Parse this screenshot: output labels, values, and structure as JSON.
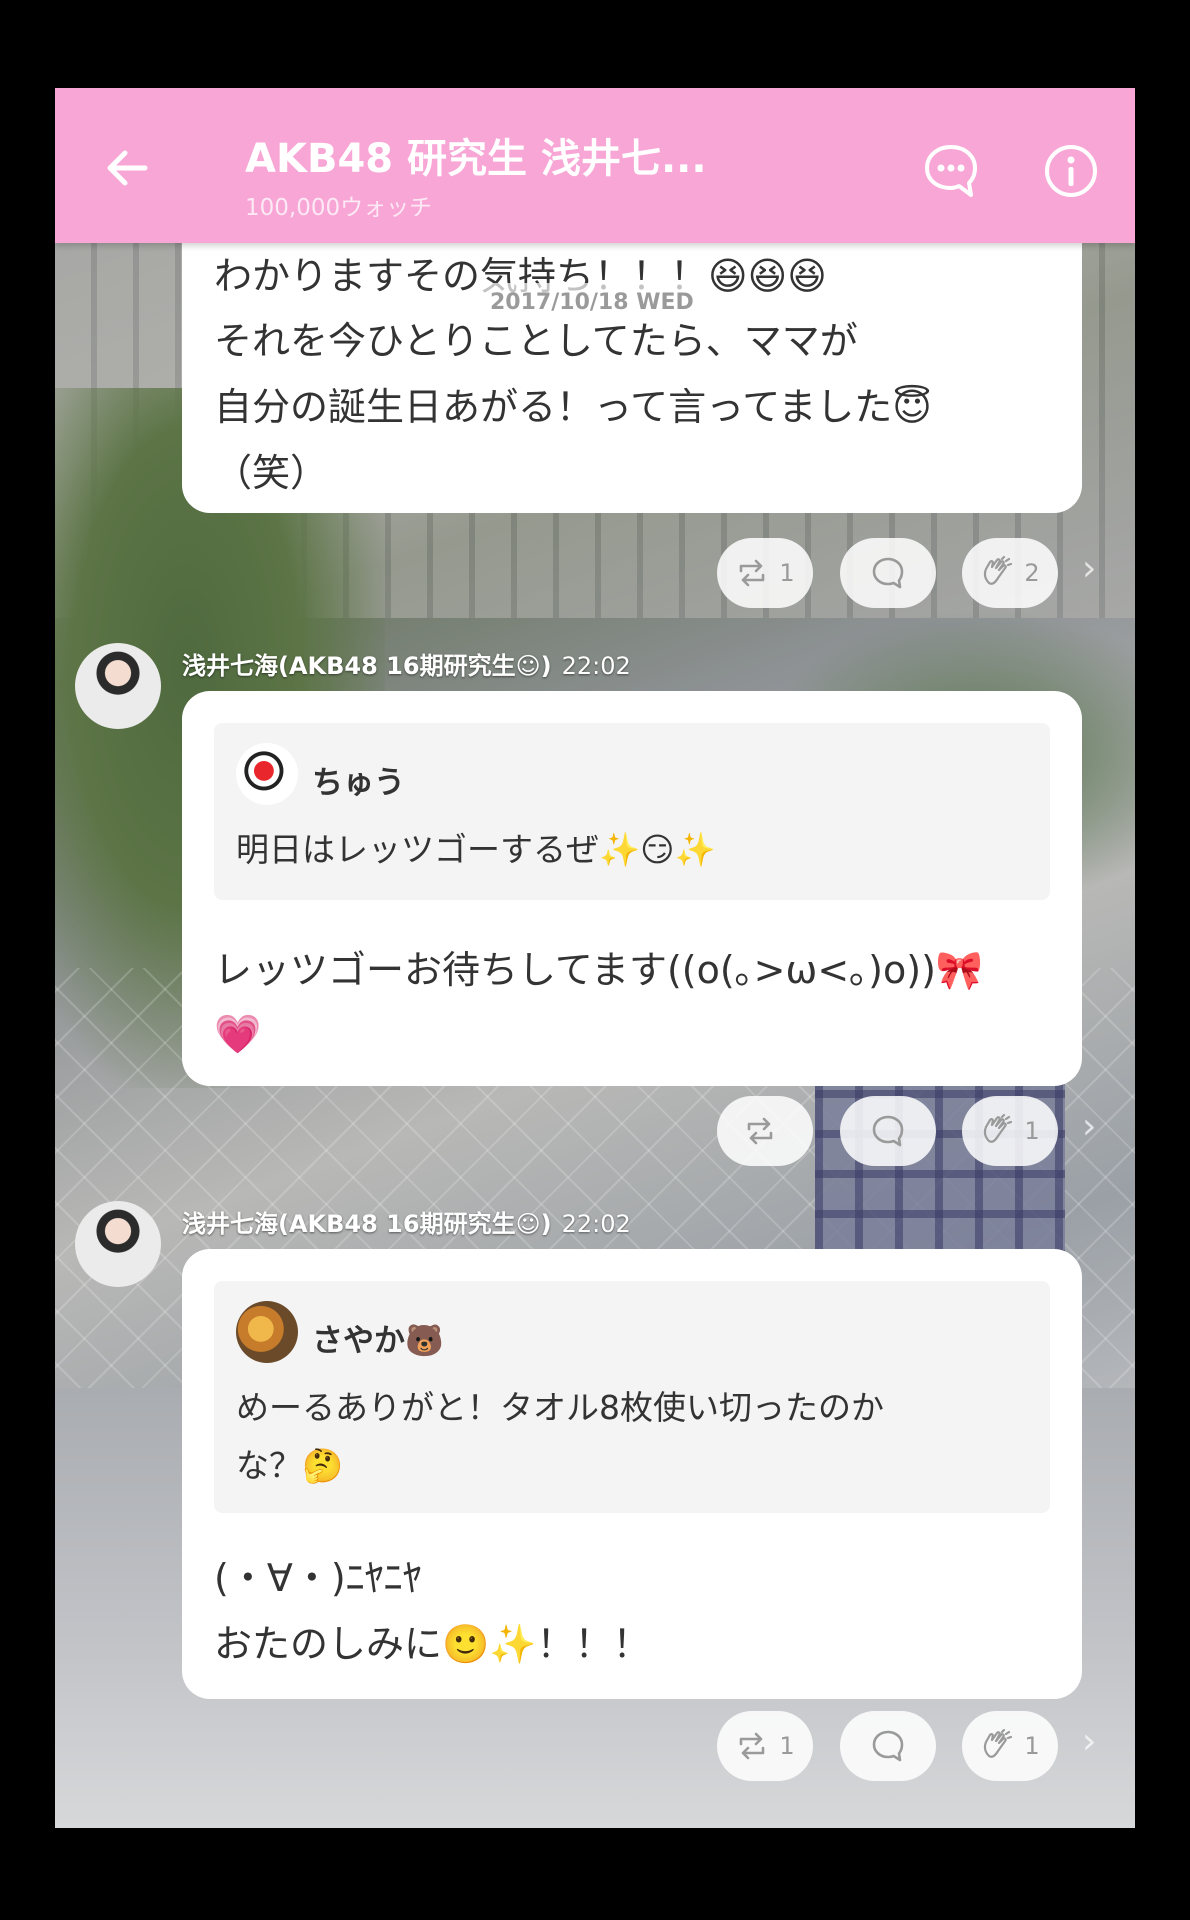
{
  "header": {
    "title": "AKB48 研究生 浅井七...",
    "subtitle": "100,000ウォッチ",
    "accent_color": "#f8a6d5"
  },
  "date_divider": "2017/10/18 WED",
  "messages": [
    {
      "lines": [
        "わかりますその気持ち！！！😆😆😆",
        "それを今ひとりことしてたら、ママが",
        "自分の誕生日あがる！って言ってました😇",
        "（笑）"
      ],
      "actions": {
        "repost_count": "1",
        "clap_count": "2"
      }
    },
    {
      "sender": "浅井七海(AKB48 16期研究生☺)",
      "time": "22:02",
      "quote": {
        "name": "ちゅう",
        "text": "明日はレッツゴーするぜ✨😏✨"
      },
      "lines": [
        "レッツゴーお待ちしてます((o(｡>ω<｡)o))🎀",
        "💗"
      ],
      "actions": {
        "repost_count": "",
        "clap_count": "1"
      }
    },
    {
      "sender": "浅井七海(AKB48 16期研究生☺)",
      "time": "22:02",
      "quote": {
        "name": "さやか🐻",
        "lines": [
          "めーるありがと！タオル8枚使い切ったのか",
          "な？🤔"
        ]
      },
      "lines": [
        "(・∀・)ﾆﾔﾆﾔ",
        "おたのしみに🙂✨！！！"
      ],
      "actions": {
        "repost_count": "1",
        "clap_count": "1"
      }
    }
  ],
  "icons": [
    "back-arrow-icon",
    "talk-bubble-icon",
    "info-icon",
    "repost-icon",
    "comment-icon",
    "clap-icon",
    "chevron-right-icon"
  ]
}
